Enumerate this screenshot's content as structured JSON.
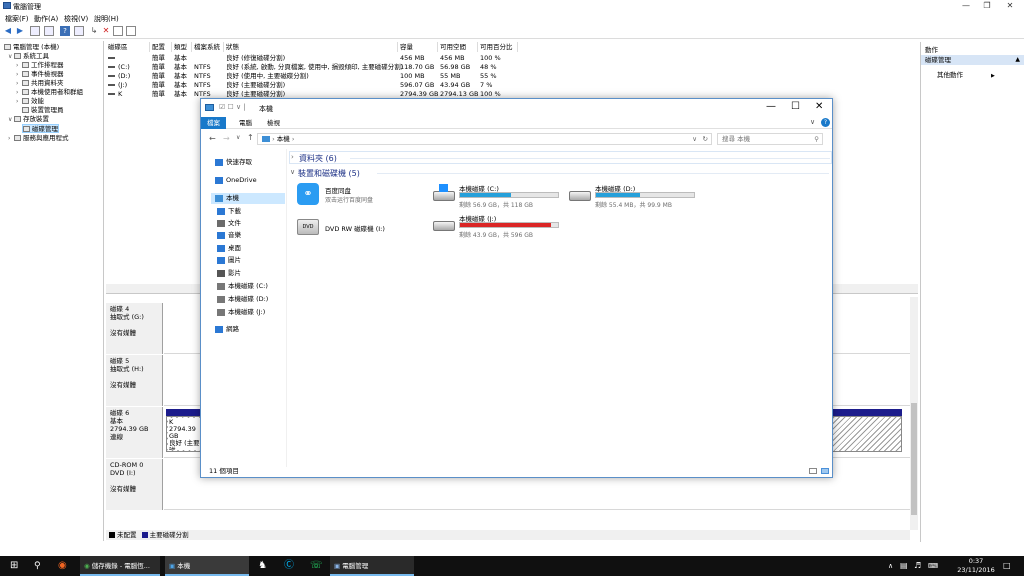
{
  "mmc": {
    "title": "電腦管理",
    "menu": [
      "檔案(F)",
      "動作(A)",
      "檢視(V)",
      "說明(H)"
    ],
    "tree": [
      {
        "label": "電腦管理 (本機)",
        "icon": "computer-management-icon"
      },
      {
        "label": "系統工具",
        "icon": "tools-icon"
      },
      {
        "label": "工作排程器",
        "icon": "clock-icon"
      },
      {
        "label": "事件檢視器",
        "icon": "event-viewer-icon"
      },
      {
        "label": "共用資料夾",
        "icon": "shared-folder-icon"
      },
      {
        "label": "本機使用者和群組",
        "icon": "users-icon"
      },
      {
        "label": "效能",
        "icon": "performance-icon"
      },
      {
        "label": "裝置管理員",
        "icon": "device-manager-icon"
      },
      {
        "label": "存放裝置",
        "icon": "storage-icon"
      },
      {
        "label": "磁碟管理",
        "icon": "disk-management-icon"
      },
      {
        "label": "服務與應用程式",
        "icon": "services-icon"
      }
    ],
    "columns": [
      "磁碟區",
      "配置",
      "類型",
      "檔案系統",
      "狀態",
      "容量",
      "可用空間",
      "可用百分比"
    ],
    "rows": [
      {
        "vol": "",
        "layout": "簡單",
        "type": "基本",
        "fs": "",
        "status": "良好 (修復磁碟分割)",
        "cap": "456 MB",
        "free": "456 MB",
        "pct": "100 %"
      },
      {
        "vol": "(C:)",
        "layout": "簡單",
        "type": "基本",
        "fs": "NTFS",
        "status": "良好 (系統, 啟動, 分頁檔案, 使用中, 損毀傾印, 主要磁碟分割)",
        "cap": "118.70 GB",
        "free": "56.98 GB",
        "pct": "48 %"
      },
      {
        "vol": "(D:)",
        "layout": "簡單",
        "type": "基本",
        "fs": "NTFS",
        "status": "良好 (使用中, 主要磁碟分割)",
        "cap": "100 MB",
        "free": "55 MB",
        "pct": "55 %"
      },
      {
        "vol": "(J:)",
        "layout": "簡單",
        "type": "基本",
        "fs": "NTFS",
        "status": "良好 (主要磁碟分割)",
        "cap": "596.07 GB",
        "free": "43.94 GB",
        "pct": "7 %"
      },
      {
        "vol": "K",
        "layout": "簡單",
        "type": "基本",
        "fs": "NTFS",
        "status": "良好 (主要磁碟分割)",
        "cap": "2794.39 GB",
        "free": "2794.13 GB",
        "pct": "100 %"
      }
    ],
    "disks": [
      {
        "name": "磁碟 4",
        "l2": "抽取式 (G:)",
        "l3": "",
        "l4": "沒有媒體"
      },
      {
        "name": "磁碟 5",
        "l2": "抽取式 (H:)",
        "l3": "",
        "l4": "沒有媒體"
      },
      {
        "name": "磁碟 6",
        "l2": "基本",
        "l3": "2794.39 GB",
        "l4": "連線",
        "part_name": "K",
        "part_size": "2794.39 GB",
        "part_status": "良好 (主要磁"
      },
      {
        "name": "CD-ROM 0",
        "l2": "DVD (I:)",
        "l3": "",
        "l4": "沒有媒體"
      }
    ],
    "legend": [
      "未配置",
      "主要磁碟分割"
    ],
    "actions_header": "動作",
    "actions_section": "磁碟管理",
    "actions_more": "其他動作"
  },
  "explorer": {
    "title": "本機",
    "tabs": [
      "檔案",
      "電腦",
      "檢視"
    ],
    "address": "本機",
    "search_placeholder": "搜尋 本機",
    "nav": [
      {
        "label": "快速存取",
        "icon": "star-icon",
        "color": "#2b78d4"
      },
      {
        "label": "OneDrive",
        "icon": "onedrive-icon",
        "color": "#2b78d4"
      },
      {
        "label": "本機",
        "icon": "computer-icon",
        "color": "#3d8fd6"
      },
      {
        "label": "下載",
        "icon": "download-icon",
        "color": "#2b78d4"
      },
      {
        "label": "文件",
        "icon": "document-icon",
        "color": "#6b6b6b"
      },
      {
        "label": "音樂",
        "icon": "music-icon",
        "color": "#2b78d4"
      },
      {
        "label": "桌面",
        "icon": "desktop-icon",
        "color": "#2b78d4"
      },
      {
        "label": "圖片",
        "icon": "pictures-icon",
        "color": "#2b78d4"
      },
      {
        "label": "影片",
        "icon": "video-icon",
        "color": "#555555"
      },
      {
        "label": "本機磁碟 (C:)",
        "icon": "drive-icon",
        "color": "#777777"
      },
      {
        "label": "本機磁碟 (D:)",
        "icon": "drive-icon",
        "color": "#777777"
      },
      {
        "label": "本機磁碟 (J:)",
        "icon": "drive-icon",
        "color": "#777777"
      },
      {
        "label": "網路",
        "icon": "network-icon",
        "color": "#2b78d4"
      }
    ],
    "folders_group": "資料夾 (6)",
    "devices_group": "裝置和磁碟機 (5)",
    "baidu_name": "百度同盘",
    "baidu_sub": "双击运行百度同盘",
    "dvd_name": "DVD RW 磁碟機 (I:)",
    "drives": [
      {
        "name": "本機磁碟 (C:)",
        "sub": "剩餘 56.9 GB，共 118 GB",
        "used": 0.52,
        "color": "#26a0da"
      },
      {
        "name": "本機磁碟 (D:)",
        "sub": "剩餘 55.4 MB，共 99.9 MB",
        "used": 0.45,
        "color": "#26a0da"
      },
      {
        "name": "本機磁碟 (J:)",
        "sub": "剩餘 43.9 GB，共 596 GB",
        "used": 0.93,
        "color": "#da2626"
      }
    ],
    "status": "11 個項目"
  },
  "taskbar": {
    "items": [
      "儲存機錄 - 電腦恆...",
      "本機",
      "電腦管理"
    ],
    "time": "0:37",
    "date": "23/11/2016"
  }
}
